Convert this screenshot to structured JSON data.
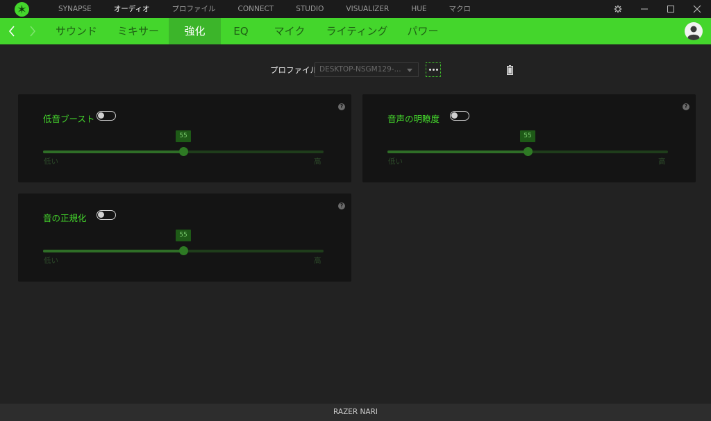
{
  "topnav": {
    "items": [
      {
        "label": "SYNAPSE",
        "active": false
      },
      {
        "label": "オーディオ",
        "active": true
      },
      {
        "label": "プロファイル",
        "active": false
      },
      {
        "label": "CONNECT",
        "active": false
      },
      {
        "label": "STUDIO",
        "active": false
      },
      {
        "label": "VISUALIZER",
        "active": false
      },
      {
        "label": "HUE",
        "active": false
      },
      {
        "label": "マクロ",
        "active": false
      }
    ],
    "icons": {
      "logo": "razer-logo-icon",
      "settings": "gear-icon",
      "minimize": "minimize-icon",
      "maximize": "maximize-icon",
      "close": "close-icon"
    }
  },
  "subnav": {
    "tabs": [
      {
        "label": "サウンド",
        "active": false
      },
      {
        "label": "ミキサー",
        "active": false
      },
      {
        "label": "強化",
        "active": true
      },
      {
        "label": "EQ",
        "active": false
      },
      {
        "label": "マイク",
        "active": false
      },
      {
        "label": "ライティング",
        "active": false
      },
      {
        "label": "パワー",
        "active": false
      }
    ],
    "icons": {
      "back": "chevron-left-icon",
      "forward": "chevron-right-icon",
      "user": "user-avatar-icon"
    }
  },
  "profile": {
    "label": "プロファイル",
    "selected": "DESKTOP-NSGM129-...",
    "more_icon": "more-dots-icon",
    "battery_icon": "battery-icon"
  },
  "panels": [
    {
      "title": "低音ブースト",
      "enabled": false,
      "value": "55",
      "low_label": "低い",
      "high_label": "高",
      "help": "?"
    },
    {
      "title": "音声の明瞭度",
      "enabled": false,
      "value": "55",
      "low_label": "低い",
      "high_label": "高",
      "help": "?"
    },
    {
      "title": "音の正規化",
      "enabled": false,
      "value": "55",
      "low_label": "低い",
      "high_label": "高",
      "help": "?"
    }
  ],
  "footer": {
    "device": "RAZER NARI"
  },
  "colors": {
    "accent": "#44d62c",
    "background": "#222222",
    "panel": "#141414",
    "topbar": "#1b1b1b"
  }
}
